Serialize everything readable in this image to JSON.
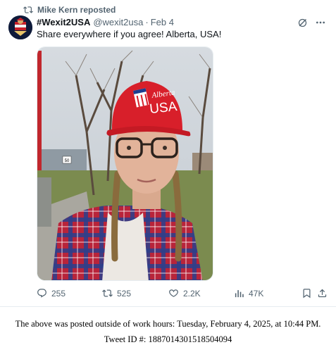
{
  "repost": {
    "icon": "repost-icon",
    "text": "Mike Kern reposted"
  },
  "tweet": {
    "display_name": "#Wexit2USA",
    "handle": "@wexit2usa",
    "separator": "·",
    "date": "Feb 4",
    "text": "Share everywhere if you agree! Alberta, USA!",
    "media": {
      "hat_line1": "Alberta",
      "hat_line2": "USA",
      "sign_number": "50"
    }
  },
  "actions": {
    "replies": "255",
    "reposts": "525",
    "likes": "2.2K",
    "views": "47K"
  },
  "caption": {
    "line1": "The above was posted outside of work hours: Tuesday, February 4, 2025, at 10:44 PM.",
    "line2": "Tweet ID #: 1887014301518504094"
  },
  "colors": {
    "secondary_text": "#536471",
    "hat_red": "#d81f2a"
  }
}
